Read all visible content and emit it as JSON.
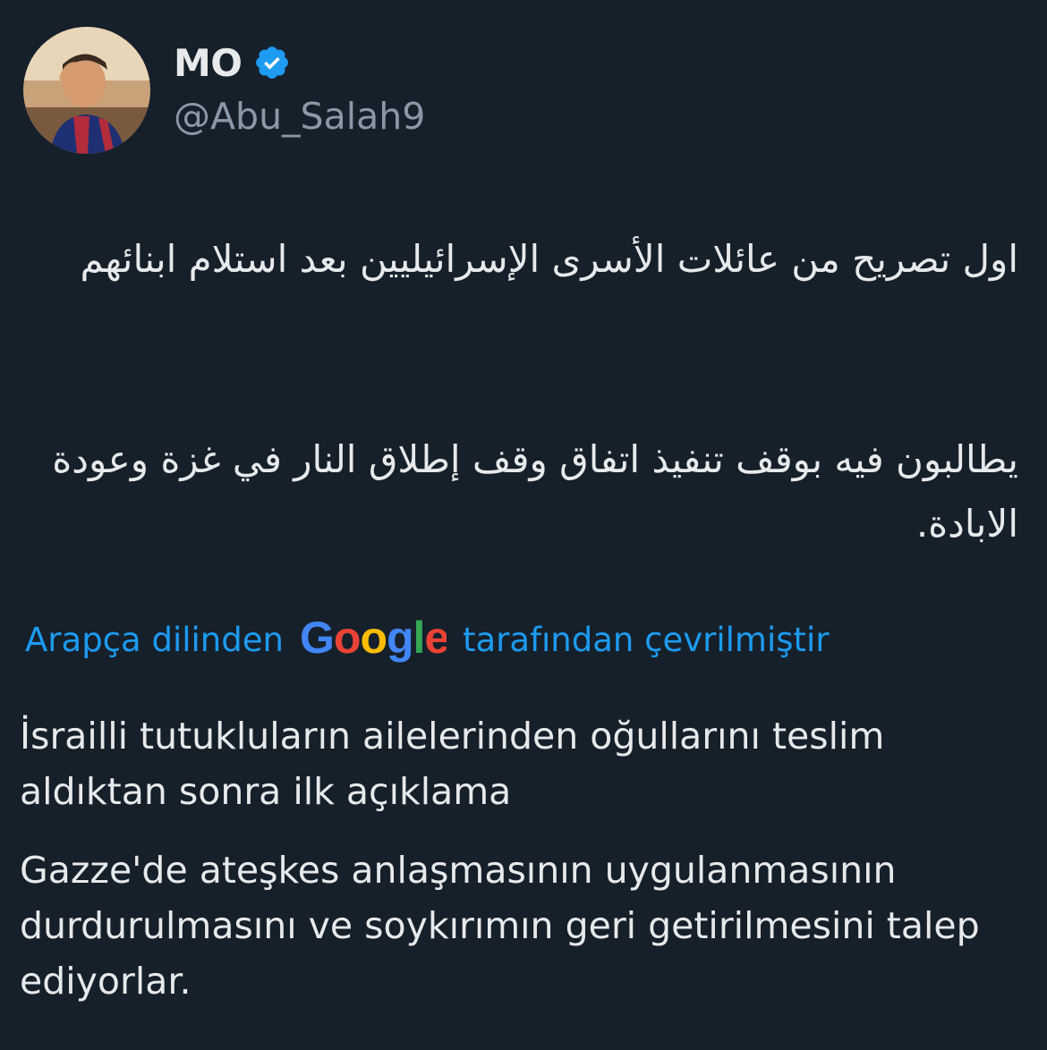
{
  "author": {
    "display_name": "MO",
    "handle": "@Abu_Salah9",
    "avatar_icon": "user-avatar-photo",
    "verified_icon": "verified-badge-icon",
    "verified_color": "#1d9bf0"
  },
  "tweet": {
    "arabic_paragraph_1": "اول تصريح من عائلات الأسرى الإسرائيليين بعد استلام ابنائهم",
    "arabic_paragraph_2": "يطالبون فيه بوقف تنفيذ اتفاق وقف إطلاق النار في غزة وعودة الابادة."
  },
  "translation": {
    "prefix": "Arapça dilinden",
    "provider_logo_text": "Google",
    "suffix": "tarafından çevrilmiştir",
    "link_color": "#1d9bf0",
    "paragraph_1": "İsrailli tutukluların ailelerinden oğullarını teslim aldıktan sonra ilk açıklama",
    "paragraph_2": "Gazze'de ateşkes anlaşmasının uygulanmasının durdurulmasını ve soykırımın geri getirilmesini talep ediyorlar."
  },
  "colors": {
    "background": "#16202b",
    "text_primary": "#e7e9ea",
    "text_secondary": "#8b98a5"
  }
}
